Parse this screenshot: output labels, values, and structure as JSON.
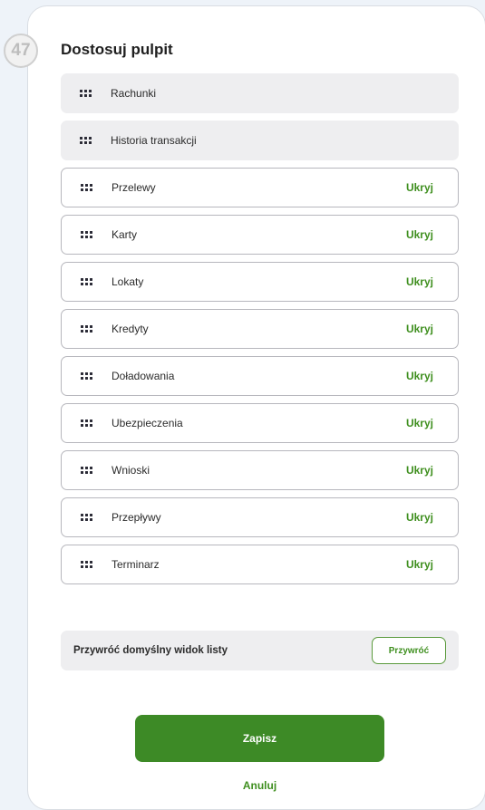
{
  "step_badge": "47",
  "dialog": {
    "title": "Dostosuj pulpit",
    "fixed_items": [
      {
        "label": "Rachunki"
      },
      {
        "label": "Historia transakcji"
      }
    ],
    "items": [
      {
        "label": "Przelewy",
        "action": "Ukryj"
      },
      {
        "label": "Karty",
        "action": "Ukryj"
      },
      {
        "label": "Lokaty",
        "action": "Ukryj"
      },
      {
        "label": "Kredyty",
        "action": "Ukryj"
      },
      {
        "label": "Doładowania",
        "action": "Ukryj"
      },
      {
        "label": "Ubezpieczenia",
        "action": "Ukryj"
      },
      {
        "label": "Wnioski",
        "action": "Ukryj"
      },
      {
        "label": "Przepływy",
        "action": "Ukryj"
      },
      {
        "label": "Terminarz",
        "action": "Ukryj"
      }
    ],
    "restore": {
      "label": "Przywróć domyślny widok listy",
      "button": "Przywróć"
    },
    "save_label": "Zapisz",
    "cancel_label": "Anuluj"
  },
  "colors": {
    "accent": "#3d8a26",
    "link": "#3f8f1f",
    "fixed_row_bg": "#eeeef0",
    "row_border": "#b7b7bd"
  },
  "icons": {
    "row_handle": "drag-handle-icon"
  }
}
